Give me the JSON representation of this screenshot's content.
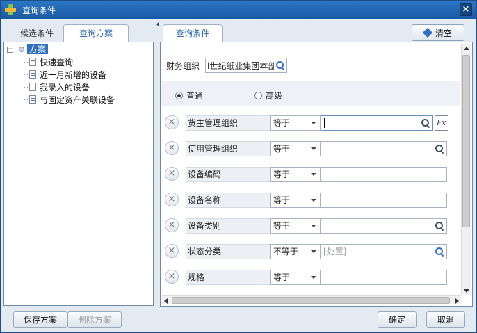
{
  "window": {
    "title": "查询条件"
  },
  "left_panel": {
    "tabs": [
      "候选条件",
      "查询方案"
    ],
    "tree": {
      "root": "方案",
      "items": [
        "快速查询",
        "近一月新增的设备",
        "我录入的设备",
        "与固定资产关联设备"
      ]
    }
  },
  "right_panel": {
    "tab": "查询条件",
    "clear_label": "清空",
    "org": {
      "label": "财务组织",
      "value": "l世纪纸业集团本部"
    },
    "radios": {
      "normal": "普通",
      "advanced": "高级",
      "selected": "normal"
    },
    "conditions": [
      {
        "field": "货主管理组织",
        "op": "等于",
        "value": "",
        "placeholder": ""
      },
      {
        "field": "使用管理组织",
        "op": "等于",
        "value": "",
        "placeholder": ""
      },
      {
        "field": "设备编码",
        "op": "等于",
        "value": "",
        "placeholder": ""
      },
      {
        "field": "设备名称",
        "op": "等于",
        "value": "",
        "placeholder": ""
      },
      {
        "field": "设备类别",
        "op": "等于",
        "value": "",
        "placeholder": ""
      },
      {
        "field": "状态分类",
        "op": "不等于",
        "value": "",
        "placeholder": "[处置]"
      },
      {
        "field": "规格",
        "op": "等于",
        "value": "",
        "placeholder": ""
      }
    ],
    "fx_label": "Fx",
    "remove_symbol": "×"
  },
  "footer": {
    "save_scheme": "保存方案",
    "delete_scheme": "删除方案",
    "ok": "确定",
    "cancel": "取消"
  }
}
